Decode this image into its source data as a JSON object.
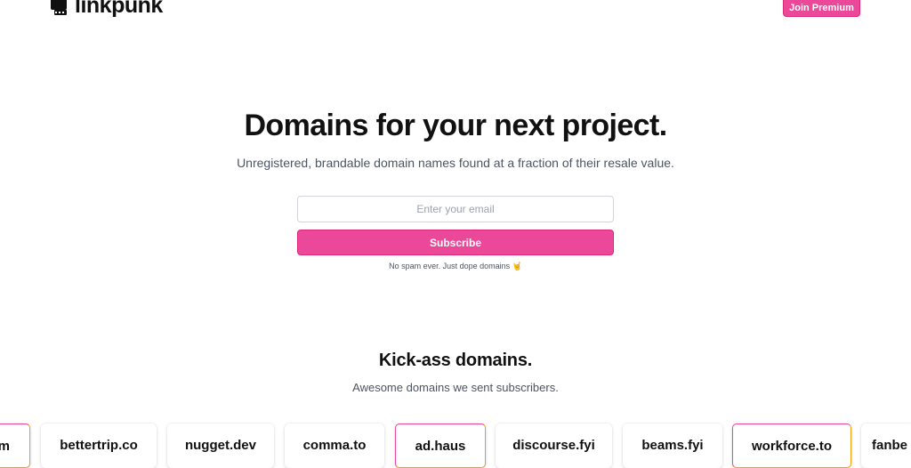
{
  "header": {
    "logo_text": "linkpunk",
    "logo_icon": "fist-icon",
    "premium_label": "Join Premium"
  },
  "hero": {
    "title": "Domains for your next project.",
    "subtitle": "Unregistered, brandable domain names found at a fraction of their resale value."
  },
  "signup": {
    "email_placeholder": "Enter your email",
    "email_value": "",
    "subscribe_label": "Subscribe",
    "fineprint": "No spam ever. Just dope domains 🤘"
  },
  "domains": {
    "title": "Kick-ass domains.",
    "subtitle": "Awesome domains we sent subscribers.",
    "items": [
      {
        "label": "m",
        "featured": true
      },
      {
        "label": "bettertrip.co",
        "featured": false
      },
      {
        "label": "nugget.dev",
        "featured": false
      },
      {
        "label": "comma.to",
        "featured": false
      },
      {
        "label": "ad.haus",
        "featured": true
      },
      {
        "label": "discourse.fyi",
        "featured": false
      },
      {
        "label": "beams.fyi",
        "featured": false
      },
      {
        "label": "workforce.to",
        "featured": true
      },
      {
        "label": "fanbe",
        "featured": false
      }
    ]
  },
  "colors": {
    "accent": "#ec4899",
    "accent_border": "#db2777",
    "featured_gradient_end": "#f59e0b",
    "muted_text": "#4b5563"
  }
}
